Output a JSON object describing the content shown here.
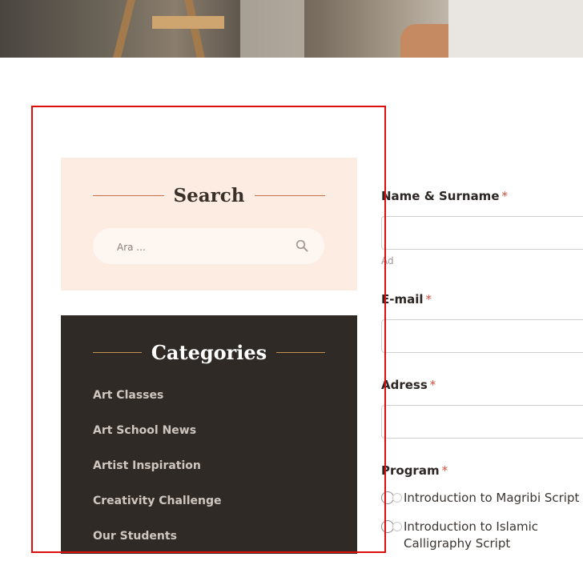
{
  "search_widget": {
    "title": "Search",
    "placeholder": "Ara ..."
  },
  "categories_widget": {
    "title": "Categories",
    "items": [
      "Art Classes",
      "Art School News",
      "Artist Inspiration",
      "Creativity Challenge",
      "Our Students"
    ]
  },
  "form": {
    "name_label": "Name & Surname",
    "name_hint": "Ad",
    "email_label": "E-mail",
    "address_label": "Adress",
    "program_label": "Program",
    "required_mark": "*",
    "program_options": [
      "Introduction to Magribi Script",
      "Introduction to Islamic Calligraphy Script"
    ]
  },
  "colors": {
    "search_bg": "#fcece2",
    "categories_bg": "#2f2a26",
    "accent_line": "#c8704a",
    "gold_line": "#c4924f",
    "required": "#d2533c",
    "highlight_frame": "#e00d0d"
  }
}
